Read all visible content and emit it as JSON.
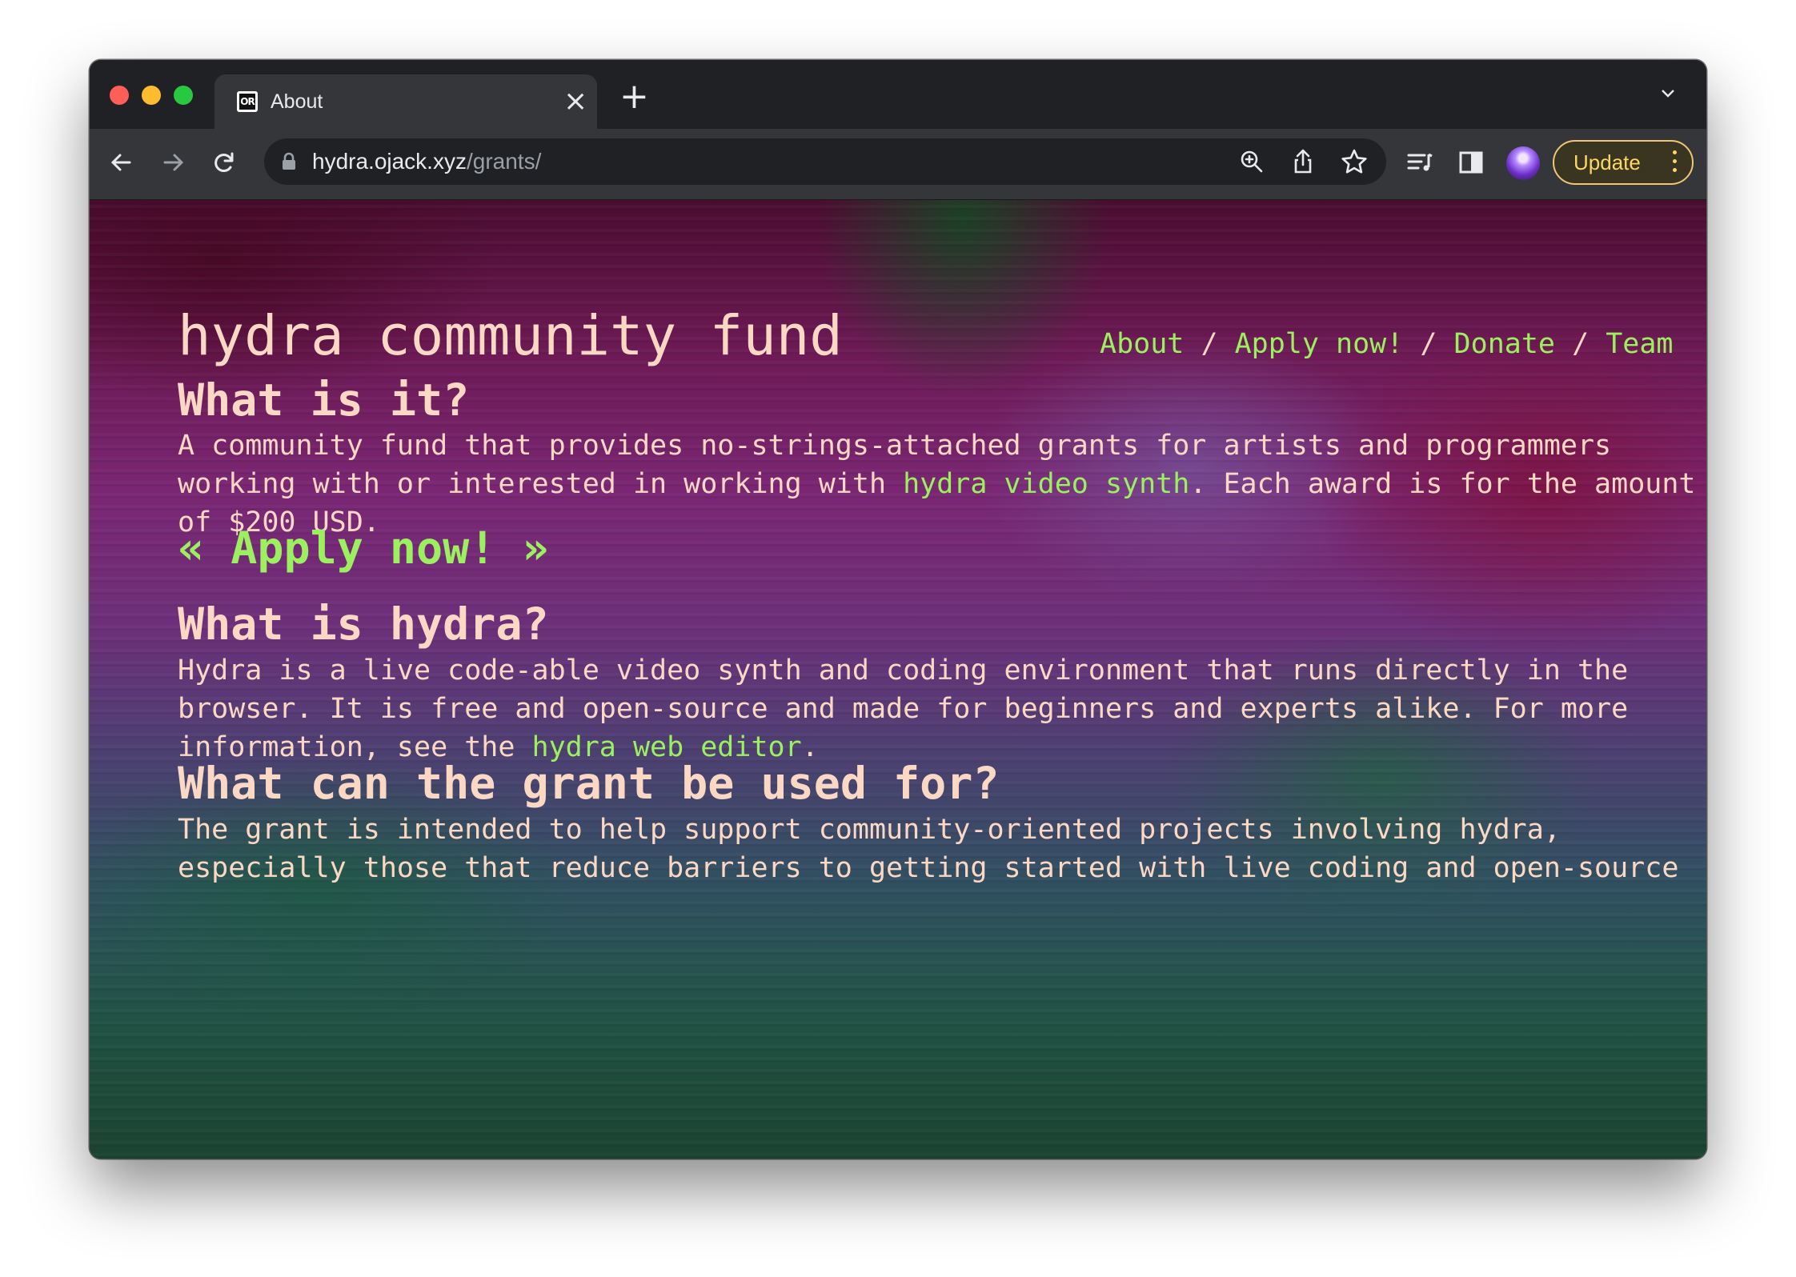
{
  "browser": {
    "tab": {
      "title": "About",
      "favicon_text": "OR"
    },
    "url": {
      "domain": "hydra.ojack.xyz",
      "path": "/grants/"
    },
    "update_label": "Update",
    "icons": [
      "back-icon",
      "forward-icon",
      "reload-icon",
      "lock-icon",
      "zoom-icon",
      "share-icon",
      "star-icon",
      "reading-list-icon",
      "side-panel-icon",
      "profile-avatar",
      "menu-icon",
      "tab-close-icon",
      "new-tab-icon",
      "tab-dropdown-icon"
    ]
  },
  "site": {
    "title": "hydra community fund",
    "nav": [
      {
        "label": "About"
      },
      {
        "label": "Apply now!"
      },
      {
        "label": "Donate"
      },
      {
        "label": "Team"
      }
    ],
    "nav_separator": "/"
  },
  "sections": {
    "what_is_it": {
      "heading": "What is it?",
      "line1": "A community fund that provides no-strings-attached grants for artists and programmers",
      "line2_before": "working with or interested in working with ",
      "line2_link": "hydra video synth",
      "line2_after": ". Each award is for the amount",
      "line3": "of $200 USD."
    },
    "apply_cta": {
      "left": "«",
      "label": "Apply now!",
      "right": "»"
    },
    "what_is_hydra": {
      "heading": "What is hydra?",
      "line1": "Hydra is a live code-able video synth and coding environment that runs directly in the",
      "line2": "browser. It is free and open-source and made for beginners and experts alike. For more",
      "line3_before": "information, see the ",
      "line3_link": "hydra web editor",
      "line3_after": "."
    },
    "grant_use": {
      "heading": "What can the grant be used for?",
      "line1": "The grant is intended to help support community-oriented projects involving hydra,",
      "line2": "especially those that reduce barriers to getting started with live coding and open-source"
    }
  },
  "colors": {
    "text": "#fbd8c4",
    "link": "#9cf05f",
    "chrome_dark": "#202124",
    "chrome_toolbar": "#35363a",
    "update_accent": "#fdd663"
  }
}
